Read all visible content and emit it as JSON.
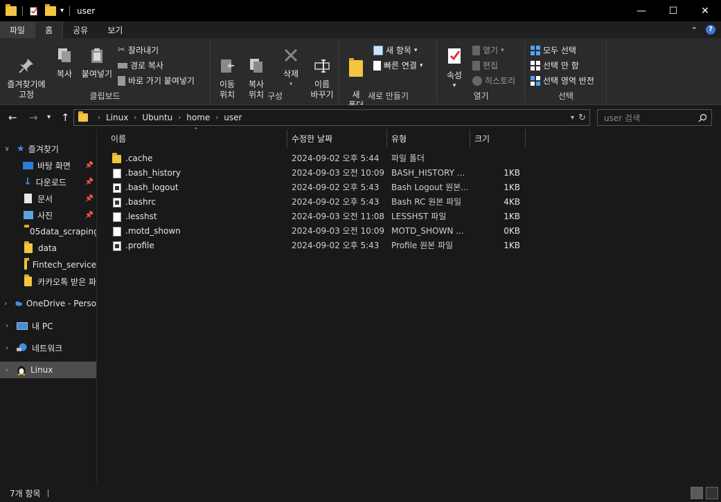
{
  "window": {
    "title": "user"
  },
  "tabs": [
    {
      "label": "파일"
    },
    {
      "label": "홈"
    },
    {
      "label": "공유"
    },
    {
      "label": "보기"
    }
  ],
  "ribbon": {
    "clipboard": {
      "label": "클립보드",
      "pin": "즐겨찾기에\n고정",
      "copy": "복사",
      "paste": "붙여넣기",
      "cut": "잘라내기",
      "copy_path": "경로 복사",
      "paste_shortcut": "바로 가기 붙여넣기"
    },
    "organize": {
      "label": "구성",
      "move_to": "이동\n위치",
      "copy_to": "복사\n위치",
      "delete": "삭제",
      "rename": "이름\n바꾸기"
    },
    "new": {
      "label": "새로 만들기",
      "new_folder": "새\n폴더",
      "new_item": "새 항목",
      "easy_access": "빠른 연결"
    },
    "open": {
      "label": "열기",
      "properties": "속성",
      "open": "열기",
      "edit": "편집",
      "history": "히스토리"
    },
    "select": {
      "label": "선택",
      "select_all": "모두 선택",
      "select_none": "선택 안 함",
      "invert": "선택 영역 반전"
    }
  },
  "address": {
    "crumbs": [
      "Linux",
      "Ubuntu",
      "home",
      "user"
    ],
    "search_placeholder": "user 검색"
  },
  "nav": {
    "quick_access": "즐겨찾기",
    "items": [
      {
        "label": "바탕 화면",
        "icon": "desktop-icon",
        "pinned": true
      },
      {
        "label": "다운로드",
        "icon": "download-icon",
        "pinned": true
      },
      {
        "label": "문서",
        "icon": "document-icon",
        "pinned": true
      },
      {
        "label": "사진",
        "icon": "picture-icon",
        "pinned": true
      },
      {
        "label": "05data_scraping",
        "icon": "folder-icon",
        "pinned": false
      },
      {
        "label": "data",
        "icon": "folder-icon",
        "pinned": false
      },
      {
        "label": "Fintech_service",
        "icon": "folder-icon",
        "pinned": false
      },
      {
        "label": "카카오톡 받은 파",
        "icon": "folder-icon",
        "pinned": false
      }
    ],
    "onedrive": "OneDrive - Perso",
    "this_pc": "내 PC",
    "network": "네트워크",
    "linux": "Linux"
  },
  "columns": {
    "name": "이름",
    "date": "수정한 날짜",
    "type": "유형",
    "size": "크기"
  },
  "files": [
    {
      "name": ".cache",
      "date": "2024-09-02 오후 5:44",
      "type": "파일 폴더",
      "size": "",
      "icon": "folder-icon"
    },
    {
      "name": ".bash_history",
      "date": "2024-09-03 오전 10:09",
      "type": "BASH_HISTORY ...",
      "size": "1KB",
      "icon": "file-icon"
    },
    {
      "name": ".bash_logout",
      "date": "2024-09-02 오후 5:43",
      "type": "Bash Logout 원본...",
      "size": "1KB",
      "icon": "text-file-icon"
    },
    {
      "name": ".bashrc",
      "date": "2024-09-02 오후 5:43",
      "type": "Bash RC 원본 파일",
      "size": "4KB",
      "icon": "text-file-icon"
    },
    {
      "name": ".lesshst",
      "date": "2024-09-03 오전 11:08",
      "type": "LESSHST 파일",
      "size": "1KB",
      "icon": "file-icon"
    },
    {
      "name": ".motd_shown",
      "date": "2024-09-03 오전 10:09",
      "type": "MOTD_SHOWN ...",
      "size": "0KB",
      "icon": "file-icon"
    },
    {
      "name": ".profile",
      "date": "2024-09-02 오후 5:43",
      "type": "Profile 원본 파일",
      "size": "1KB",
      "icon": "text-file-icon"
    }
  ],
  "status": {
    "count": "7개 항목"
  }
}
